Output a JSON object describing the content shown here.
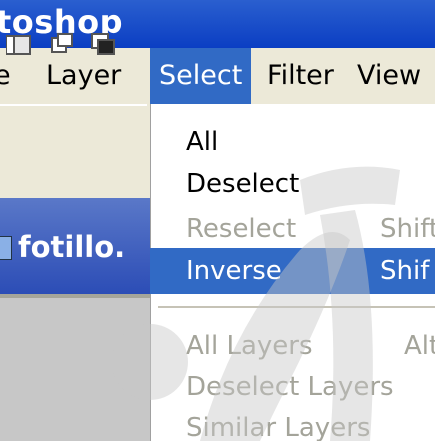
{
  "app": {
    "title_fragment": "toshop"
  },
  "menubar": {
    "items": [
      {
        "label": "e",
        "active": false
      },
      {
        "label": "Layer",
        "active": false
      },
      {
        "label": "Select",
        "active": true
      },
      {
        "label": "Filter",
        "active": false
      },
      {
        "label": "View",
        "active": false
      }
    ]
  },
  "toolbar": {
    "buttons": [
      "new-selection-icon",
      "add-to-selection-icon",
      "subtract-from-selection-icon",
      "intersect-selection-icon"
    ]
  },
  "document": {
    "title": "fotillo."
  },
  "select_menu": {
    "items": [
      {
        "label": "All",
        "shortcut": "",
        "state": "enabled"
      },
      {
        "label": "Deselect",
        "shortcut": "",
        "state": "enabled"
      },
      {
        "label": "Reselect",
        "shortcut": "Shift",
        "state": "disabled"
      },
      {
        "label": "Inverse",
        "shortcut": "Shif",
        "state": "highlighted"
      },
      {
        "label": "All Layers",
        "shortcut": "Alt",
        "state": "disabled"
      },
      {
        "label": "Deselect Layers",
        "shortcut": "",
        "state": "disabled"
      },
      {
        "label": "Similar Layers",
        "shortcut": "",
        "state": "disabled"
      }
    ]
  },
  "colors": {
    "titlebar": "#0b3ec3",
    "highlight": "#316ac5",
    "menu_bg": "#ece9d8",
    "disabled_text": "#a4a49a"
  }
}
